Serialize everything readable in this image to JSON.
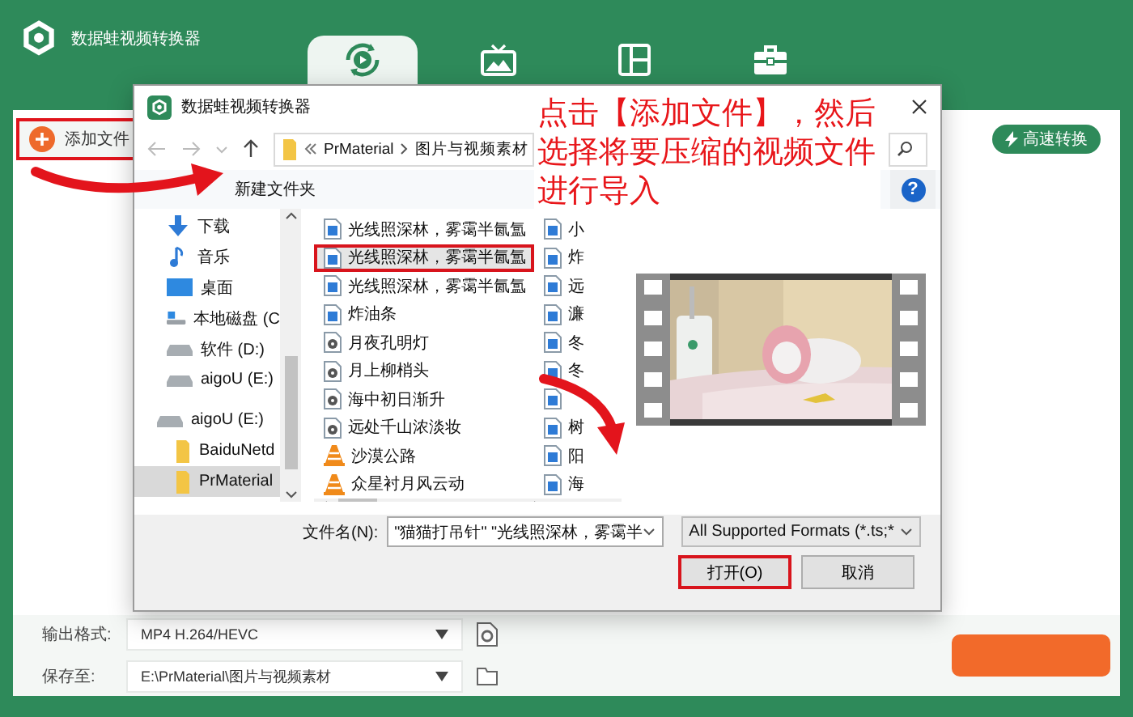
{
  "app": {
    "title": "数据蛙视频转换器"
  },
  "tabs": [
    {
      "kind": "convert",
      "selected": true
    },
    {
      "kind": "tv",
      "selected": false
    },
    {
      "kind": "layout",
      "selected": false
    },
    {
      "kind": "toolbox",
      "selected": false
    }
  ],
  "toolbar": {
    "add_file_button": {
      "label": "添加文件",
      "highlighted": true
    },
    "fast_convert_button": {
      "label": "高速转换"
    }
  },
  "dialog": {
    "title": "数据蛙视频转换器",
    "path": [
      "PrMaterial",
      "图片与视频素材"
    ],
    "new_folder": "新建文件夹",
    "help_button": "?",
    "nav_items": [
      {
        "kind": "download",
        "label": "下载",
        "selected": false
      },
      {
        "kind": "music",
        "label": "音乐",
        "selected": false
      },
      {
        "kind": "desktop",
        "label": "桌面",
        "selected": false
      },
      {
        "kind": "system-drive",
        "label": "本地磁盘 (C",
        "selected": false
      },
      {
        "kind": "drive",
        "label": "软件 (D:)",
        "selected": false
      },
      {
        "kind": "drive",
        "label": "aigoU (E:)",
        "selected": false
      },
      {
        "kind": "drive",
        "label": "aigoU (E:)",
        "selected": false,
        "children": [
          {
            "kind": "folder",
            "label": "BaiduNetd",
            "selected": false
          },
          {
            "kind": "folder",
            "label": "PrMaterial",
            "selected": true
          }
        ]
      }
    ],
    "files_column_1": [
      {
        "kind": "video",
        "name": "光线照深林，雾霭半氤氲",
        "selected": false,
        "highlighted": false
      },
      {
        "kind": "video",
        "name": "光线照深林，雾霭半氤氲",
        "selected": true,
        "highlighted": true
      },
      {
        "kind": "video",
        "name": "光线照深林，雾霭半氤氲",
        "selected": false,
        "highlighted": false
      },
      {
        "kind": "video",
        "name": "炸油条",
        "selected": false,
        "highlighted": false
      },
      {
        "kind": "media",
        "name": "月夜孔明灯",
        "selected": false,
        "highlighted": false
      },
      {
        "kind": "media",
        "name": "月上柳梢头",
        "selected": false,
        "highlighted": false
      },
      {
        "kind": "media",
        "name": "海中初日渐升",
        "selected": false,
        "highlighted": false
      },
      {
        "kind": "media",
        "name": "远处千山浓淡妆",
        "selected": false,
        "highlighted": false
      },
      {
        "kind": "cone",
        "name": "沙漠公路",
        "selected": false,
        "highlighted": false
      },
      {
        "kind": "cone",
        "name": "众星衬月风云动",
        "selected": false,
        "highlighted": false
      }
    ],
    "files_column_2": [
      {
        "kind": "video",
        "name": "小"
      },
      {
        "kind": "video",
        "name": "炸"
      },
      {
        "kind": "video",
        "name": "远"
      },
      {
        "kind": "video",
        "name": "濂"
      },
      {
        "kind": "video",
        "name": "冬"
      },
      {
        "kind": "video",
        "name": "冬"
      },
      {
        "kind": "video"
      },
      {
        "kind": "video",
        "name": "树"
      },
      {
        "kind": "video",
        "name": "阳"
      },
      {
        "kind": "video",
        "name": "海"
      }
    ],
    "preview": {
      "kind": "picture"
    },
    "filename": {
      "label": "文件名(N):",
      "value": "\"猫猫打吊针\" \"光线照深林，雾霭半"
    },
    "filter": "All Supported Formats (*.ts;*",
    "buttons": [
      {
        "label": "打开(O)",
        "highlighted": true
      },
      {
        "label": "取消",
        "highlighted": false
      }
    ]
  },
  "footer": {
    "output_format": {
      "label": "输出格式:",
      "value": "MP4 H.264/HEVC"
    },
    "save_to": {
      "label": "保存至:",
      "value": "E:\\PrMaterial\\图片与视频素材"
    }
  },
  "annotation": {
    "lines": [
      "点击【添加文件】，然后",
      "选择将要压缩的视频文件",
      "进行导入"
    ]
  }
}
